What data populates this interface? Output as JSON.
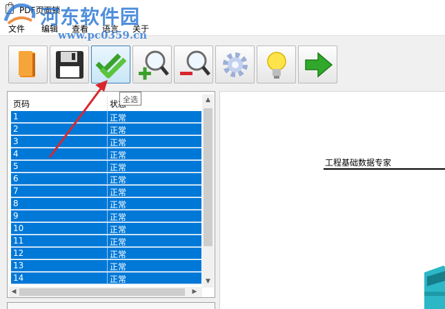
{
  "app": {
    "title": "PDF页面锁"
  },
  "watermark": {
    "site_name": "河东软件园",
    "url": "www.pc0359.cn"
  },
  "menu": [
    {
      "label": "文件"
    },
    {
      "label": "编辑"
    },
    {
      "label": "查看"
    },
    {
      "label": "语言"
    },
    {
      "label": "关于"
    }
  ],
  "toolbar": {
    "buttons": [
      {
        "icon": "open-book-icon"
      },
      {
        "icon": "save-disk-icon"
      },
      {
        "icon": "double-check-icon"
      },
      {
        "icon": "zoom-in-icon"
      },
      {
        "icon": "zoom-out-icon"
      },
      {
        "icon": "gear-icon"
      },
      {
        "icon": "lightbulb-icon"
      },
      {
        "icon": "green-arrow-icon"
      }
    ],
    "tooltip": "全选"
  },
  "table": {
    "headers": [
      "页码",
      "状态"
    ],
    "rows": [
      [
        "1",
        "正常"
      ],
      [
        "2",
        "正常"
      ],
      [
        "3",
        "正常"
      ],
      [
        "4",
        "正常"
      ],
      [
        "5",
        "正常"
      ],
      [
        "6",
        "正常"
      ],
      [
        "7",
        "正常"
      ],
      [
        "8",
        "正常"
      ],
      [
        "9",
        "正常"
      ],
      [
        "10",
        "正常"
      ],
      [
        "11",
        "正常"
      ],
      [
        "12",
        "正常"
      ],
      [
        "13",
        "正常"
      ],
      [
        "14",
        "正常"
      ]
    ]
  },
  "preview": {
    "doc_header": "工程基础数据专家"
  },
  "colors": {
    "selection": "#0078d7",
    "annotation_arrow": "#d9272e",
    "watermark": "#1e6ed2"
  }
}
